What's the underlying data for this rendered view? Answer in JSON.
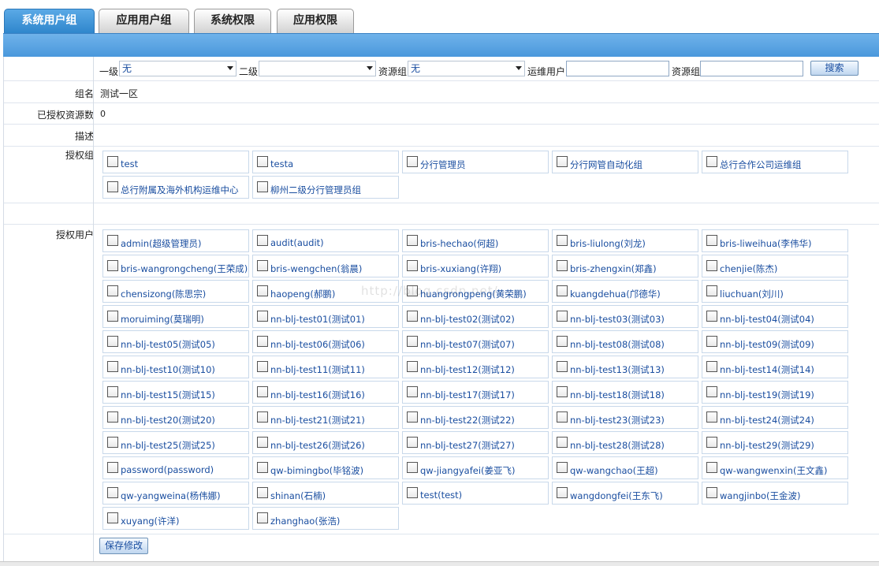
{
  "tabs": [
    {
      "label": "系统用户组",
      "active": true
    },
    {
      "label": "应用用户组",
      "active": false
    },
    {
      "label": "系统权限",
      "active": false
    },
    {
      "label": "应用权限",
      "active": false
    }
  ],
  "filter": {
    "level1_label": "一级",
    "level1_value": "无",
    "level2_label": "二级",
    "level2_value": "",
    "resgroup_label": "资源组",
    "resgroup_value": "无",
    "opuser_label": "运维用户",
    "opuser_value": "",
    "resgroup2_label": "资源组",
    "resgroup2_value": "",
    "search_label": "搜索"
  },
  "details": {
    "group_name_label": "组名",
    "group_name_value": "测试一区",
    "auth_count_label": "已授权资源数",
    "auth_count_value": "0",
    "desc_label": "描述",
    "desc_value": ""
  },
  "auth_groups": {
    "label": "授权组",
    "items": [
      "test",
      "testa",
      "分行管理员",
      "分行网管自动化组",
      "总行合作公司运维组",
      "总行附属及海外机构运维中心",
      "柳州二级分行管理员组"
    ]
  },
  "auth_users": {
    "label": "授权用户",
    "items": [
      "admin(超级管理员)",
      "audit(audit)",
      "bris-hechao(何超)",
      "bris-liulong(刘龙)",
      "bris-liweihua(李伟华)",
      "bris-wangrongcheng(王荣成)",
      "bris-wengchen(翁晨)",
      "bris-xuxiang(许翔)",
      "bris-zhengxin(郑鑫)",
      "chenjie(陈杰)",
      "chensizong(陈思宗)",
      "haopeng(郝鹏)",
      "huangrongpeng(黄荣鹏)",
      "kuangdehua(邝德华)",
      "liuchuan(刘川)",
      "moruiming(莫瑞明)",
      "nn-blj-test01(测试01)",
      "nn-blj-test02(测试02)",
      "nn-blj-test03(测试03)",
      "nn-blj-test04(测试04)",
      "nn-blj-test05(测试05)",
      "nn-blj-test06(测试06)",
      "nn-blj-test07(测试07)",
      "nn-blj-test08(测试08)",
      "nn-blj-test09(测试09)",
      "nn-blj-test10(测试10)",
      "nn-blj-test11(测试11)",
      "nn-blj-test12(测试12)",
      "nn-blj-test13(测试13)",
      "nn-blj-test14(测试14)",
      "nn-blj-test15(测试15)",
      "nn-blj-test16(测试16)",
      "nn-blj-test17(测试17)",
      "nn-blj-test18(测试18)",
      "nn-blj-test19(测试19)",
      "nn-blj-test20(测试20)",
      "nn-blj-test21(测试21)",
      "nn-blj-test22(测试22)",
      "nn-blj-test23(测试23)",
      "nn-blj-test24(测试24)",
      "nn-blj-test25(测试25)",
      "nn-blj-test26(测试26)",
      "nn-blj-test27(测试27)",
      "nn-blj-test28(测试28)",
      "nn-blj-test29(测试29)",
      "password(password)",
      "qw-bimingbo(毕铭波)",
      "qw-jiangyafei(姜亚飞)",
      "qw-wangchao(王超)",
      "qw-wangwenxin(王文鑫)",
      "qw-yangweina(杨伟娜)",
      "shinan(石楠)",
      "test(test)",
      "wangdongfei(王东飞)",
      "wangjinbo(王金波)",
      "xuyang(许洋)",
      "zhanghao(张浩)"
    ]
  },
  "save_label": "保存修改",
  "watermark": "http://blog.csdn.net/"
}
